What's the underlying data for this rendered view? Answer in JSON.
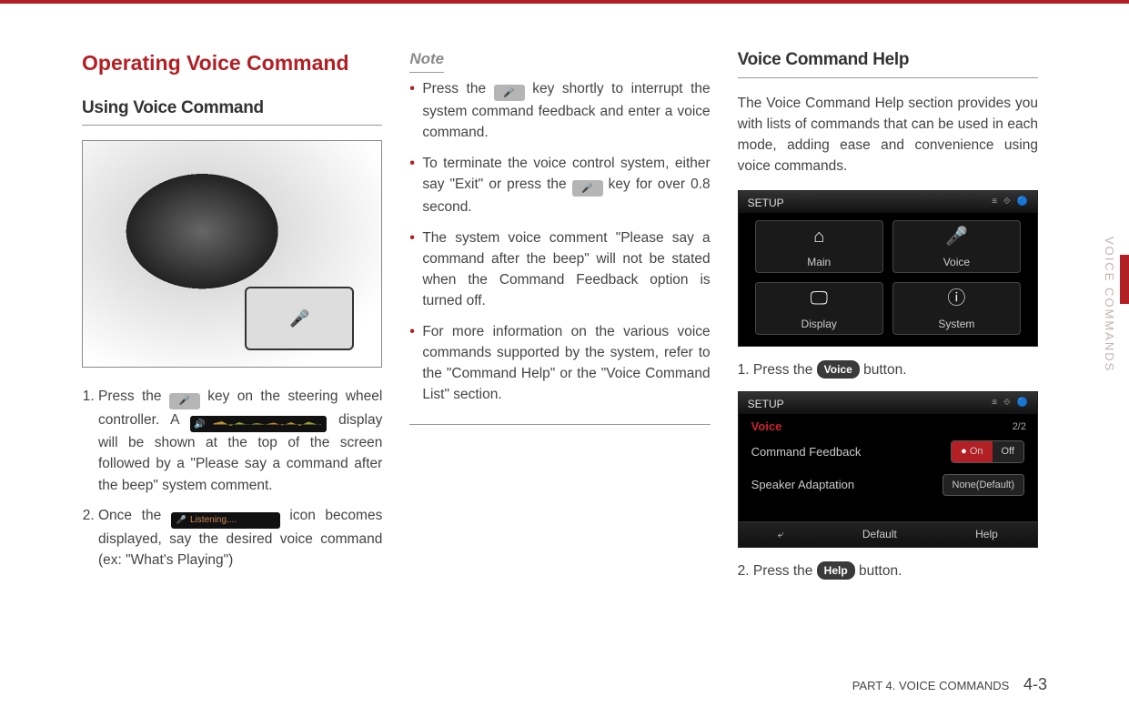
{
  "side_tab": "VOICE COMMANDS",
  "footer": {
    "part": "PART 4. VOICE COMMANDS",
    "page": "4-3"
  },
  "col1": {
    "title": "Operating Voice Command",
    "subtitle": "Using Voice Command",
    "steps": {
      "s1a": "Press the ",
      "s1b": " key on the steering wheel controller. A ",
      "s1c": " display will be shown at the top of the screen followed by a \"Please say a command after the beep\" system comment.",
      "s2a": "Once the ",
      "s2b": " icon becomes displayed, say the desired voice command (ex: \"What's Playing\")"
    },
    "listening_label": "Listening...."
  },
  "col2": {
    "note_label": "Note",
    "bul1a": "Press the ",
    "bul1b": " key shortly to interrupt the system command feedback and enter a voice command.",
    "bul2a": "To terminate the voice control system, either say \"Exit\" or press the ",
    "bul2b": " key for over 0.8 second.",
    "bul3": "The system voice comment \"Please say a command after the beep\" will not be stated when the Command Feedback option is turned off.",
    "bul4": "For more information on the various voice commands supported by the system, refer to the \"Command Help\" or the \"Voice Command List\" section."
  },
  "col3": {
    "subtitle": "Voice Command Help",
    "intro": "The Voice Command Help section provides you with lists of commands that can be used in each mode, adding ease and convenience using voice commands.",
    "screen1": {
      "header": "SETUP",
      "status_icons": "≡ ⟐ 🔵",
      "tiles": {
        "main": "Main",
        "voice": "Voice",
        "display": "Display",
        "system": "System"
      }
    },
    "step1a": "1. Press the ",
    "step1_btn": "Voice",
    "step1b": " button.",
    "screen2": {
      "header": "SETUP",
      "status_icons": "≡ ⟐ 🔵",
      "voice_title": "Voice",
      "page_ind": "2/2",
      "row1_label": "Command Feedback",
      "row1_on": "On",
      "row1_off": "Off",
      "row2_label": "Speaker Adaptation",
      "row2_val": "None(Default)",
      "bottom": {
        "back": "⤶",
        "default": "Default",
        "help": "Help"
      }
    },
    "step2a": "2. Press the ",
    "step2_btn": "Help",
    "step2b": " button."
  }
}
